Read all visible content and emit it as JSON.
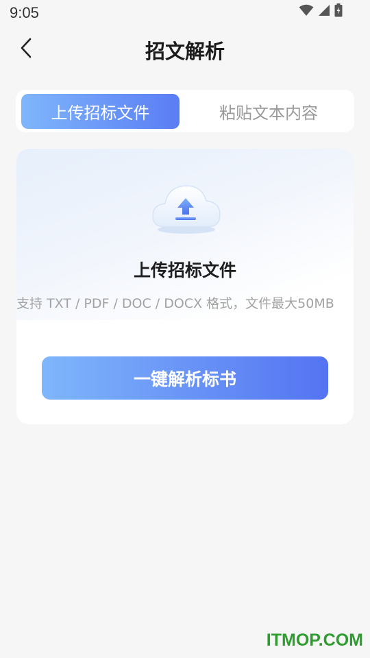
{
  "status_bar": {
    "time": "9:05",
    "icons": [
      "wifi-icon",
      "signal-icon",
      "battery-icon"
    ]
  },
  "header": {
    "title": "招文解析",
    "back_icon": "chevron-left-icon"
  },
  "tabs": [
    {
      "label": "上传招标文件",
      "active": true
    },
    {
      "label": "粘贴文本内容",
      "active": false
    }
  ],
  "upload": {
    "icon": "cloud-upload-icon",
    "title": "上传招标文件",
    "hint": "支持 TXT / PDF / DOC / DOCX 格式，文件最大50MB",
    "button_label": "一键解析标书"
  },
  "watermark": "ITMOP.COM",
  "colors": {
    "background": "#f6f6f7",
    "accent_start": "#7fb6fb",
    "accent_end": "#5473f2",
    "watermark": "#2e9c2e"
  }
}
